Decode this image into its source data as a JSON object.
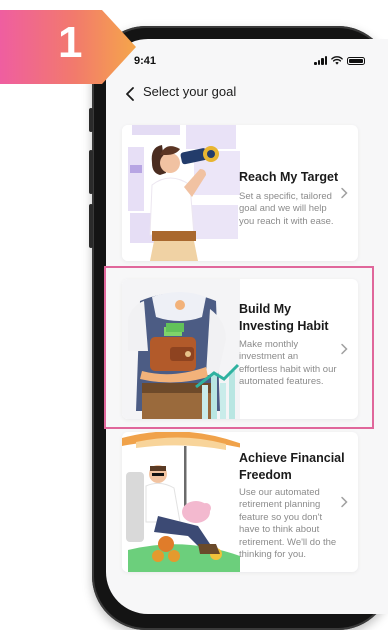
{
  "step_badge": {
    "number": "1"
  },
  "status_bar": {
    "time": "9:41"
  },
  "header": {
    "title": "Select your goal"
  },
  "goals": [
    {
      "title": "Reach My Target",
      "description": "Set a specific, tailored goal and we will help you reach it with ease."
    },
    {
      "title": "Build My Investing Habit",
      "description": "Make monthly investment an effortless habit with our automated features."
    },
    {
      "title": "Achieve Financial Freedom",
      "description": "Use our automated retirement planning feature so you don't have to think about retirement. We'll do the thinking for you."
    }
  ],
  "colors": {
    "badge_gradient_start": "#ef5ea0",
    "badge_gradient_end": "#f5a64a",
    "highlight": "#e0679b",
    "screen_background": "#f7f7f8"
  },
  "icons": [
    "back-arrow-icon",
    "chevron-right-icon",
    "cellular-signal-icon",
    "wifi-icon",
    "battery-icon"
  ]
}
